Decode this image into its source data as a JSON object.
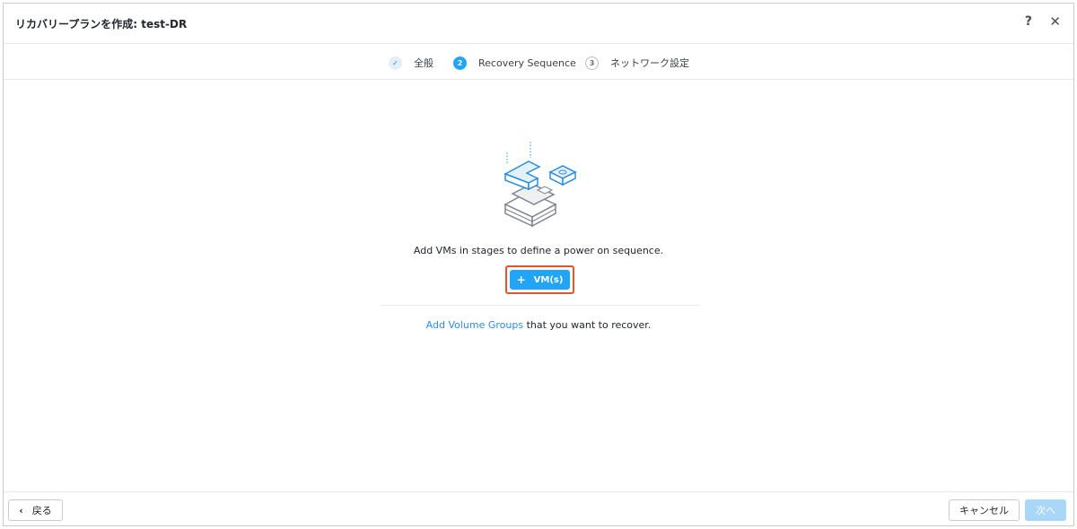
{
  "dialog": {
    "title": "リカバリープランを作成: test-DR",
    "help_label": "?",
    "close_label": "✕"
  },
  "steps": [
    {
      "number": "✓",
      "label": "全般",
      "state": "done"
    },
    {
      "number": "2",
      "label": "Recovery Sequence",
      "state": "active"
    },
    {
      "number": "3",
      "label": "ネットワーク設定",
      "state": "pending"
    }
  ],
  "main": {
    "illustration": "stacked-vm-blocks-illustration",
    "prompt": "Add VMs in stages to define a power on sequence.",
    "add_vm_button": {
      "plus": "+",
      "label": "VM(s)"
    },
    "volume_groups": {
      "link_text": "Add Volume Groups",
      "suffix": " that you want to recover."
    }
  },
  "footer": {
    "back_chevron": "‹",
    "back_label": "戻る",
    "cancel_label": "キャンセル",
    "next_label": "次へ"
  },
  "colors": {
    "accent": "#22a5f7",
    "link": "#2b8de0",
    "highlight_border": "#e8532b",
    "disabled_primary": "#a9d7f8"
  }
}
